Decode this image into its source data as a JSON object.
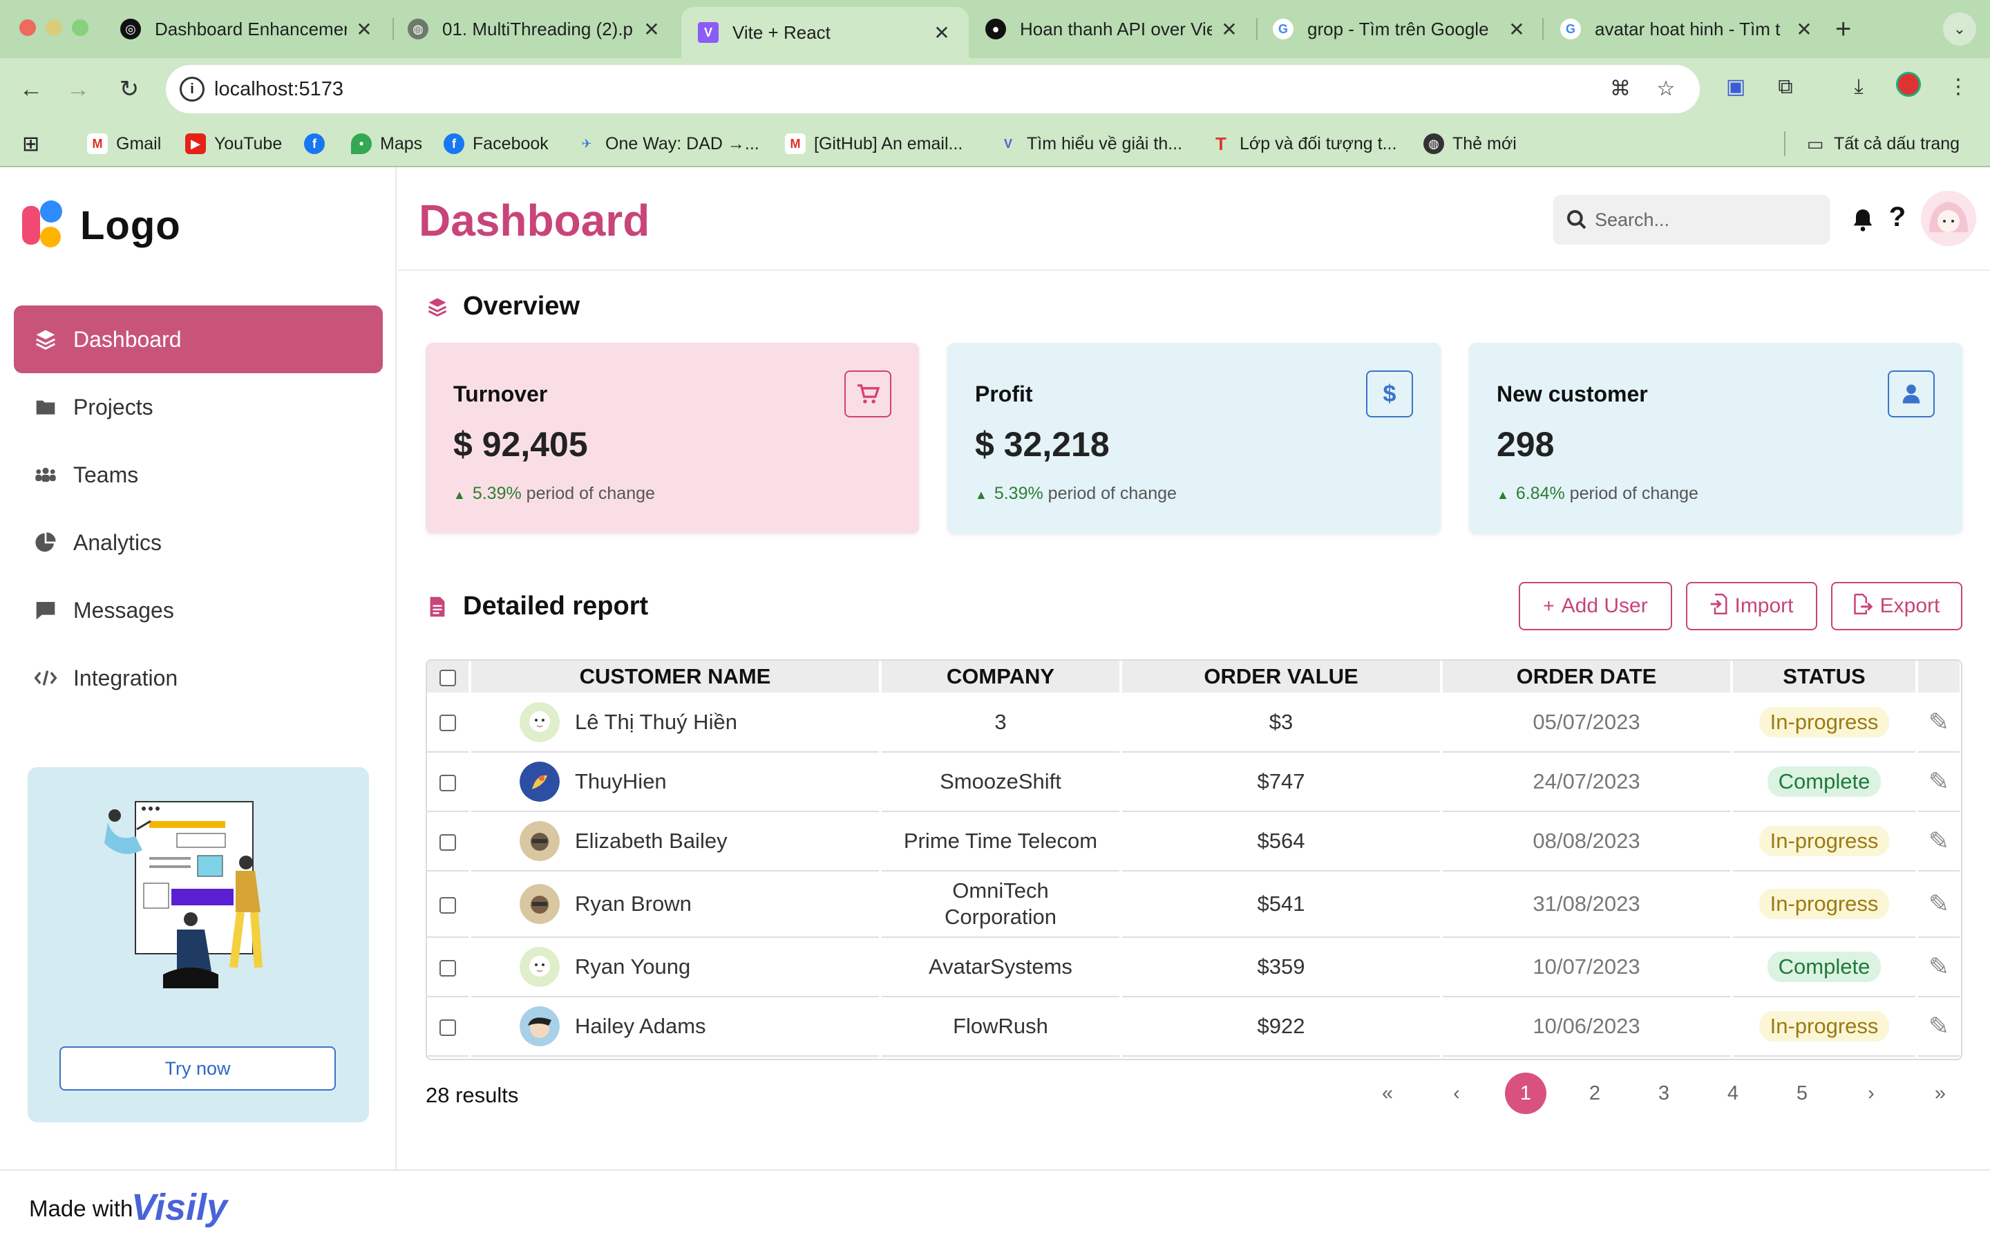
{
  "browser": {
    "tabs": [
      {
        "title": "Dashboard Enhancement",
        "favicon": "openai-icon",
        "active": false
      },
      {
        "title": "01. MultiThreading (2).p",
        "favicon": "globe-icon",
        "active": false
      },
      {
        "title": "Vite + React",
        "favicon": "vite-icon",
        "active": true
      },
      {
        "title": "Hoan thanh API over Vie",
        "favicon": "github-icon",
        "active": false
      },
      {
        "title": "grop - Tìm trên Google",
        "favicon": "google-icon",
        "active": false
      },
      {
        "title": "avatar hoat hinh - Tìm t",
        "favicon": "google-icon",
        "active": false
      }
    ],
    "url": "localhost:5173",
    "bookmarks": [
      {
        "label": "Gmail",
        "icon": "gmail-icon"
      },
      {
        "label": "YouTube",
        "icon": "youtube-icon"
      },
      {
        "label": "",
        "icon": "facebook-icon"
      },
      {
        "label": "Maps",
        "icon": "maps-icon"
      },
      {
        "label": "Facebook",
        "icon": "facebook-icon"
      },
      {
        "label": "One Way: DAD →...",
        "icon": "bird-icon"
      },
      {
        "label": "[GitHub] An email...",
        "icon": "gmail-icon"
      },
      {
        "label": "Tìm hiểu về giải th...",
        "icon": "v-icon"
      },
      {
        "label": "Lớp và đối tượng t...",
        "icon": "t-icon"
      },
      {
        "label": "Thẻ mới",
        "icon": "globe-icon"
      }
    ],
    "all_bookmarks": "Tất cả dấu trang"
  },
  "app": {
    "logo_text": "Logo",
    "nav": [
      {
        "label": "Dashboard",
        "icon": "layers-icon",
        "active": true
      },
      {
        "label": "Projects",
        "icon": "folder-icon",
        "active": false
      },
      {
        "label": "Teams",
        "icon": "team-icon",
        "active": false
      },
      {
        "label": "Analytics",
        "icon": "pie-chart-icon",
        "active": false
      },
      {
        "label": "Messages",
        "icon": "message-icon",
        "active": false
      },
      {
        "label": "Integration",
        "icon": "code-icon",
        "active": false
      }
    ],
    "promo_button": "Try now",
    "page_title": "Dashboard",
    "search_placeholder": "Search...",
    "overview_title": "Overview",
    "cards": [
      {
        "label": "Turnover",
        "value": "$ 92,405",
        "change": "5.39%",
        "change_suffix": "period of change",
        "icon": "cart-icon",
        "bg": "#f9dfe5",
        "accent": "#d6406e"
      },
      {
        "label": "Profit",
        "value": "$ 32,218",
        "change": "5.39%",
        "change_suffix": "period of change",
        "icon": "dollar-icon",
        "bg": "#e3f3f8",
        "accent": "#3b73c8"
      },
      {
        "label": "New customer",
        "value": "298",
        "change": "6.84%",
        "change_suffix": "period of change",
        "icon": "user-icon",
        "bg": "#e3f3f8",
        "accent": "#3b73c8"
      }
    ],
    "report_title": "Detailed report",
    "buttons": {
      "add_user": "Add User",
      "import": "Import",
      "export": "Export"
    },
    "table": {
      "columns": [
        "CUSTOMER NAME",
        "COMPANY",
        "ORDER VALUE",
        "ORDER DATE",
        "STATUS"
      ],
      "rows": [
        {
          "name": "Lê Thị Thuý Hiền",
          "company": "3",
          "value": "$3",
          "date": "05/07/2023",
          "status": "In-progress"
        },
        {
          "name": "ThuyHien",
          "company": "SmoozeShift",
          "value": "$747",
          "date": "24/07/2023",
          "status": "Complete"
        },
        {
          "name": "Elizabeth Bailey",
          "company": "Prime Time Telecom",
          "value": "$564",
          "date": "08/08/2023",
          "status": "In-progress"
        },
        {
          "name": "Ryan Brown",
          "company": "OmniTech Corporation",
          "value": "$541",
          "date": "31/08/2023",
          "status": "In-progress"
        },
        {
          "name": "Ryan Young",
          "company": "AvatarSystems",
          "value": "$359",
          "date": "10/07/2023",
          "status": "Complete"
        },
        {
          "name": "Hailey Adams",
          "company": "FlowRush",
          "value": "$922",
          "date": "10/06/2023",
          "status": "In-progress"
        }
      ]
    },
    "results": "28 results",
    "pagination": {
      "first": "«",
      "prev": "‹",
      "pages": [
        "1",
        "2",
        "3",
        "4",
        "5"
      ],
      "current": "1",
      "next": "›",
      "last": "»"
    },
    "footer": {
      "made_with": "Made with",
      "brand": "Visily"
    }
  }
}
